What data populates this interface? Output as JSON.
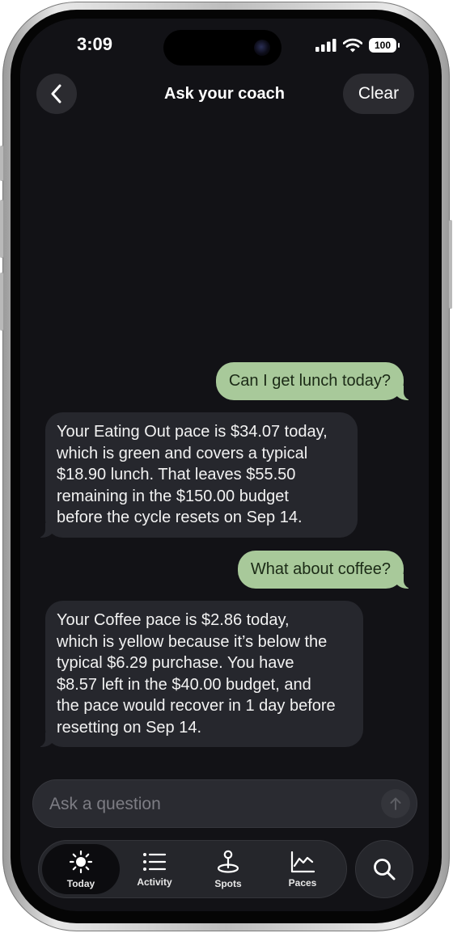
{
  "status_bar": {
    "time": "3:09",
    "battery": "100"
  },
  "nav": {
    "title": "Ask your coach",
    "clear_label": "Clear",
    "back_icon": "chevron-left-icon"
  },
  "messages": [
    {
      "role": "user",
      "text": "Can I get lunch today?"
    },
    {
      "role": "coach",
      "lines": [
        "Your Eating Out pace is $34.07 today,",
        "which is green and covers a typical",
        "$18.90 lunch. That leaves $55.50",
        "remaining in the $150.00 budget",
        "before the cycle resets on Sep 14."
      ]
    },
    {
      "role": "user",
      "text": "What about coffee?"
    },
    {
      "role": "coach",
      "lines": [
        "Your Coffee pace is $2.86 today,",
        "which is yellow because it’s below the",
        "typical $6.29 purchase. You have",
        "$8.57 left in the $40.00 budget, and",
        "the pace would recover in 1 day before",
        "resetting on Sep 14."
      ]
    }
  ],
  "composer": {
    "placeholder": "Ask a question",
    "send_icon": "arrow-up-icon"
  },
  "tabs": [
    {
      "label": "Today",
      "icon": "sun-icon",
      "active": true
    },
    {
      "label": "Activity",
      "icon": "list-icon",
      "active": false
    },
    {
      "label": "Spots",
      "icon": "map-pin-icon",
      "active": false
    },
    {
      "label": "Paces",
      "icon": "chart-line-icon",
      "active": false
    }
  ],
  "search_icon": "search-icon",
  "colors": {
    "user_bubble": "#a8c99a",
    "coach_bubble": "#26272d",
    "background": "#121216"
  }
}
